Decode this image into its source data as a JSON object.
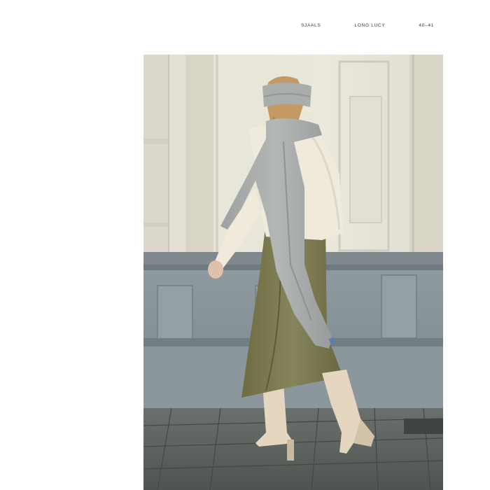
{
  "header": {
    "section": "SJAALS",
    "pattern_name": "LONG LUCY",
    "page_numbers": "40–41"
  },
  "photo": {
    "subject": "woman-walking-in-long-grey-scarf",
    "colors": {
      "wall": "#e6e3d6",
      "plinth": "#8d979d",
      "pavement": "#5c615e",
      "scarf": "#a9adac",
      "sweater": "#efeadb",
      "skirt": "#7c7a4f",
      "boots": "#e4d6bf"
    }
  }
}
